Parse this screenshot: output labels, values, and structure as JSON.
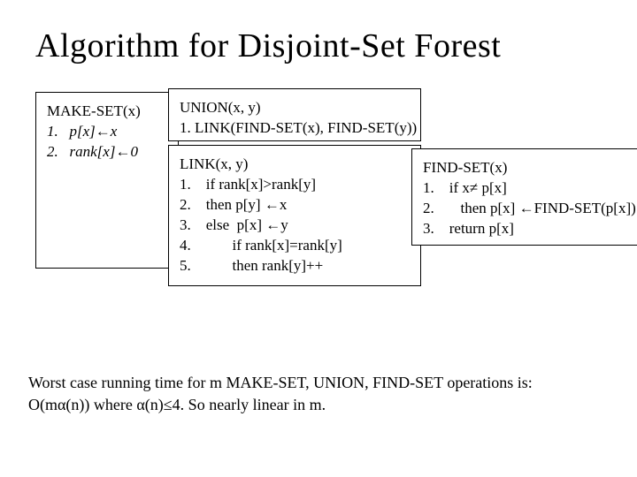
{
  "title": "Algorithm for Disjoint-Set Forest",
  "make": {
    "header": "MAKE-SET(x)",
    "l1": "1.   p[x]←x",
    "l2": "2.   rank[x]←0"
  },
  "union": {
    "header": "UNION(x, y)",
    "l1": "1. LINK(FIND-SET(x), FIND-SET(y))"
  },
  "link": {
    "header": "LINK(x, y)",
    "l1": "1.    if rank[x]>rank[y]",
    "l2": "2.    then p[y] ←x",
    "l3": "3.    else  p[x] ←y",
    "l4": "4.           if rank[x]=rank[y]",
    "l5": "5.           then rank[y]++"
  },
  "find": {
    "header": "FIND-SET(x)",
    "l1": "1.    if x≠ p[x]",
    "l2": "2.       then p[x] ←FIND-SET(p[x])",
    "l3": "3.    return p[x]"
  },
  "footer": {
    "l1": "Worst case running time for m MAKE-SET, UNION, FIND-SET operations is:",
    "l2": "O(mα(n))  where  α(n)≤4. So nearly linear in m."
  }
}
